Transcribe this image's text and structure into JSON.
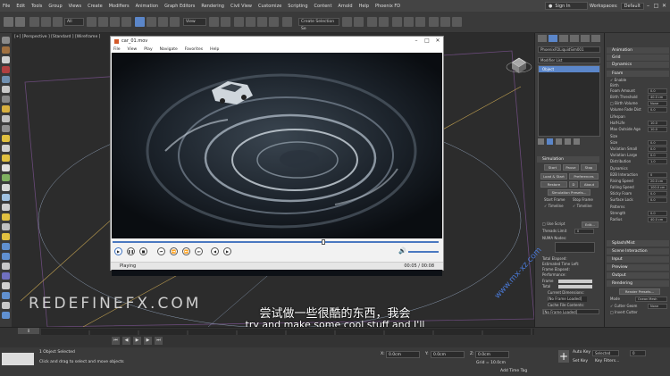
{
  "menubar": {
    "items": [
      "File",
      "Edit",
      "Tools",
      "Group",
      "Views",
      "Create",
      "Modifiers",
      "Animation",
      "Graph Editors",
      "Rendering",
      "Civil View",
      "Customize",
      "Scripting",
      "Content",
      "Arnold",
      "Help",
      "Phoenix FD"
    ],
    "signin": "Sign In",
    "workspace_label": "Workspaces:",
    "workspace_value": "Default"
  },
  "toolbar": {
    "undo_dd": "All",
    "view_dd": "View",
    "selection_set": "Create Selection Se"
  },
  "viewport": {
    "label": "[+] [Perspective ] [Standard ] [Wireframe ]"
  },
  "player": {
    "title": "car_01.mov",
    "menu": [
      "File",
      "View",
      "Play",
      "Navigate",
      "Favorites",
      "Help"
    ],
    "status": "Playing",
    "time": "00:05 / 00:08"
  },
  "cmdpanel": {
    "object_name": "PhoenixFDLiquidSim001",
    "modifier_list": "Modifier List",
    "stack_item": "Object",
    "simulation": {
      "header": "Simulation",
      "start": "Start",
      "pause": "Pause",
      "stop": "Stop",
      "load_start": "Load & Start",
      "preferences": "Preferences",
      "restore": "Restore",
      "d": "D",
      "about": "About",
      "presets": "Simulation Presets...",
      "start_frame": "Start Frame",
      "stop_frame": "Stop Frame",
      "timeline": "Timeline",
      "timeline2": "Timeline",
      "use_script": "Use Script",
      "edit": "Edit...",
      "threads_limit": "Threads Limit",
      "threads_val": "0",
      "numa": "NUMA Nodes:",
      "total_elapsed": "Total Elapsed:",
      "est_time": "Estimated Time Left:",
      "frame_elapsed": "Frame Elapsed:",
      "performance": "Performance:",
      "frame": "Frame",
      "total": "Total",
      "cur_dims": "Current Dimensions:",
      "no_frame1": "[No Frame Loaded]",
      "cache_contents": "Cache File Contents:",
      "no_frame2": "[No Frame Loaded]"
    }
  },
  "propspanel": {
    "animation": "Animation",
    "grid": "Grid",
    "dynamics": "Dynamics",
    "foam": "Foam",
    "enable": "Enable",
    "birth": "Birth",
    "foam_amount": {
      "label": "Foam Amount",
      "value": "0.0"
    },
    "birth_threshold": {
      "label": "Birth Threshold",
      "value": "40.0 cm"
    },
    "birth_volume": {
      "label": "Birth Volume",
      "value": "None"
    },
    "volume_fade": {
      "label": "Volume Fade Dist",
      "value": "0.0"
    },
    "lifespan": "Lifespan",
    "half_life": {
      "label": "Half-Life",
      "value": "10.0"
    },
    "max_outside": {
      "label": "Max Outside Age",
      "value": "10.0"
    },
    "size_hdr": "Size",
    "size": {
      "label": "Size",
      "value": "0.0"
    },
    "var_small": {
      "label": "Variation Small",
      "value": "0.0"
    },
    "var_large": {
      "label": "Variation Large",
      "value": "0.0"
    },
    "distribution": {
      "label": "Distribution",
      "value": "1.0"
    },
    "dynamics2": "Dynamics",
    "b2b": {
      "label": "B2B Interaction",
      "value": "0"
    },
    "rising_speed": {
      "label": "Rising Speed",
      "value": "20.0 cm"
    },
    "falling_speed": {
      "label": "Falling Speed",
      "value": "100.0 cm"
    },
    "sticky_foam": {
      "label": "Sticky Foam",
      "value": "0.0"
    },
    "surface_lock": {
      "label": "Surface Lock",
      "value": "0.0"
    },
    "patterns": "Patterns",
    "strength": {
      "label": "Strength",
      "value": "0.0"
    },
    "radius": {
      "label": "Radius",
      "value": "40.0 cm"
    },
    "splash_mist": "Splash/Mist",
    "scene_interaction": "Scene Interaction",
    "input": "Input",
    "preview": "Preview",
    "output": "Output",
    "rendering": "Rendering",
    "render_presets": "Render Presets...",
    "mode_label": "Mode",
    "mode_value": "Ocean Mesh",
    "cutter_geom": "Cutter Geom",
    "cutter_val": "None",
    "invert_cutter": "Invert Cutter"
  },
  "subtitles": {
    "cn": "尝试做一些很酷的东西，我会",
    "en": "try and make some cool stuff and I'll"
  },
  "watermark": "REDEFINEFX.COM",
  "site_watermark": "www.mx-xz.com",
  "timeline": {
    "start": "0",
    "ticks": [
      "0",
      "10",
      "20",
      "30",
      "40",
      "50",
      "60",
      "70",
      "80",
      "90",
      "100"
    ]
  },
  "status": {
    "selected": "1 Object Selected",
    "prompt": "Click and drag to select and move objects",
    "x_label": "X:",
    "x_value": "0.0cm",
    "y_label": "Y:",
    "y_value": "0.0cm",
    "z_label": "Z:",
    "z_value": "0.0cm",
    "grid": "Grid = 10.0cm",
    "add_time_tag": "Add Time Tag",
    "auto_key": "Auto Key",
    "selected_dd": "Selected",
    "set_key": "Set Key",
    "key_filters": "Key Filters...",
    "frame": "0"
  },
  "colors": {
    "accent": "#5b86c9",
    "menubar": "#444444",
    "panel": "#3d3d3d"
  }
}
